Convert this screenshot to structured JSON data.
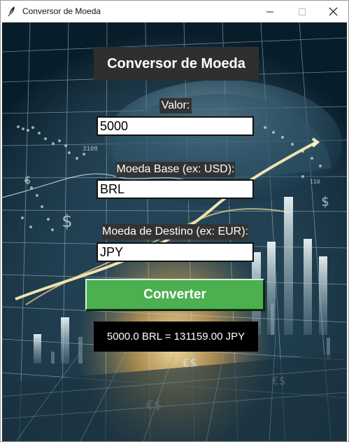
{
  "window": {
    "title": "Conversor de Moeda"
  },
  "app": {
    "heading": "Conversor de Moeda",
    "amount_label": "Valor:",
    "amount_value": "5000",
    "base_label": "Moeda Base (ex: USD):",
    "base_value": "BRL",
    "destination_label": "Moeda de Destino (ex: EUR):",
    "destination_value": "JPY",
    "convert_label": "Converter",
    "result_text": "5000.0 BRL = 131159.00 JPY"
  },
  "background": {
    "left_number": "3108",
    "right_number": "110",
    "currency_symbol": "$",
    "small_symbol": "$",
    "right_symbol": "$",
    "footer_glyph": "€$"
  },
  "colors": {
    "convert_button": "#4caf50",
    "heading_background": "#2f2f2f",
    "label_background": "#333333",
    "result_background": "#000000"
  },
  "icons": {
    "app": "feather-icon",
    "minimize": "minimize-icon",
    "maximize": "maximize-icon",
    "close": "close-icon"
  }
}
